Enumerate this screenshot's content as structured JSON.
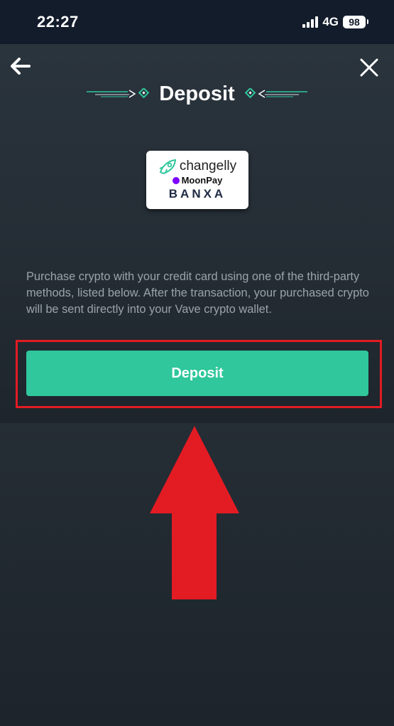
{
  "status_bar": {
    "time": "22:27",
    "network": "4G",
    "battery": "98"
  },
  "header": {
    "title": "Deposit",
    "back_icon": "arrow-left-icon",
    "close_icon": "close-icon"
  },
  "providers": {
    "changelly": "changelly",
    "moonpay": "MoonPay",
    "banxa": "BANXA"
  },
  "description": "Purchase crypto with your credit card using one of the third-party methods, listed below. After the transaction, your purchased crypto will be sent directly into your Vave crypto wallet.",
  "actions": {
    "deposit_label": "Deposit"
  },
  "colors": {
    "accent": "#2fc79b",
    "highlight": "#e31b23",
    "arrow": "#e31b23",
    "status_bg": "#131c2b"
  }
}
